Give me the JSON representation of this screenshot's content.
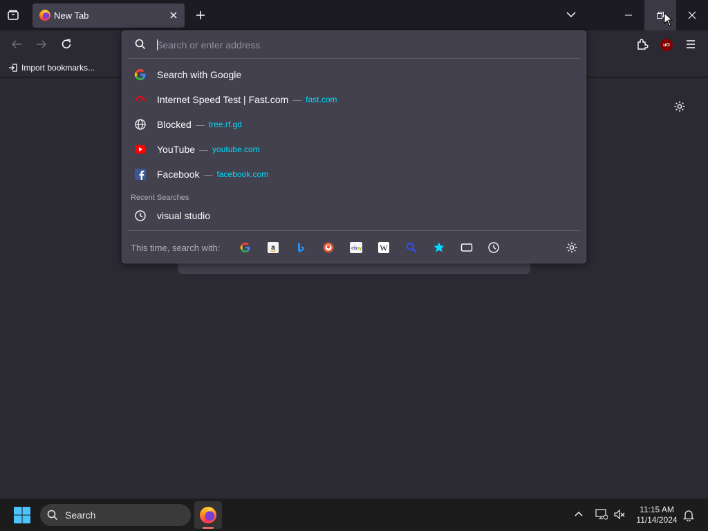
{
  "browser": {
    "tab": {
      "title": "New Tab"
    },
    "bookmarks_bar": {
      "import_label": "Import bookmarks..."
    },
    "urlbar": {
      "placeholder": "Search or enter address",
      "value": ""
    },
    "results": [
      {
        "icon": "google-icon",
        "title": "Search with Google",
        "url": ""
      },
      {
        "icon": "fast-com-icon",
        "title": "Internet Speed Test | Fast.com",
        "url": "fast.com"
      },
      {
        "icon": "globe-icon",
        "title": "Blocked",
        "url": "tree.rf.gd"
      },
      {
        "icon": "youtube-icon",
        "title": "YouTube",
        "url": "youtube.com"
      },
      {
        "icon": "facebook-icon",
        "title": "Facebook",
        "url": "facebook.com"
      }
    ],
    "recent_searches": {
      "label": "Recent Searches",
      "items": [
        {
          "icon": "clock-icon",
          "title": "visual studio"
        }
      ]
    },
    "separator": "—",
    "one_offs": {
      "label": "This time, search with:",
      "engines": [
        "google-icon",
        "amazon-icon",
        "bing-icon",
        "duckduckgo-icon",
        "ebay-icon",
        "wikipedia-icon",
        "search-engine-icon",
        "bookmarks-star-icon",
        "tabs-icon",
        "history-icon"
      ]
    },
    "colors": {
      "accent_url": "#00ddff",
      "panel": "#42414d",
      "background": "#2b2a33"
    }
  },
  "taskbar": {
    "search_label": "Search",
    "clock": {
      "time": "11:15 AM",
      "date": "11/14/2024"
    }
  }
}
